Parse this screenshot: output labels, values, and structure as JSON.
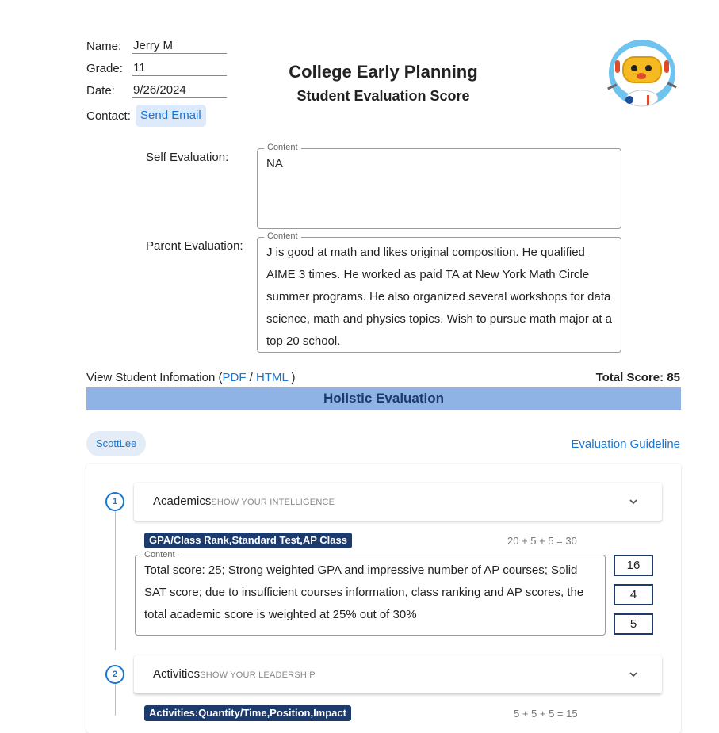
{
  "student": {
    "name_label": "Name:",
    "name_value": "Jerry M",
    "grade_label": "Grade:",
    "grade_value": "11",
    "date_label": "Date:",
    "date_value": "9/26/2024",
    "contact_label": "Contact:",
    "send_email_label": "Send Email"
  },
  "header": {
    "title": "College Early Planning",
    "subtitle": "Student Evaluation Score",
    "mascot_icon": "astronaut-mascot"
  },
  "self_evaluation": {
    "label": "Self Evaluation:",
    "legend": "Content",
    "text": "NA"
  },
  "parent_evaluation": {
    "label": "Parent Evaluation:",
    "legend": "Content",
    "text": "J is good at math and likes original composition. He qualified AIME 3 times. He worked as paid TA at New York Math Circle summer programs. He also organized several workshops for data science, math and physics topics. Wish to pursue math major at a top 20 school."
  },
  "student_info": {
    "prefix": "View Student Infomation (",
    "pdf_label": "PDF",
    "separator": " / ",
    "html_label": "HTML",
    "suffix": " )",
    "total_score": "Total Score: 85"
  },
  "holistic": {
    "title": "Holistic Evaluation",
    "evaluator_chip": "ScottLee",
    "guideline_link": "Evaluation Guideline"
  },
  "steps": [
    {
      "number": "1",
      "title": "Academics",
      "subtitle": "SHOW YOUR INTELLIGENCE",
      "tag": "GPA/Class Rank,Standard Test,AP Class",
      "formula": "20 + 5 + 5 = 30",
      "legend": "Content",
      "comment": "Total score: 25; Strong weighted GPA and impressive number of AP courses; Solid SAT score; due to insufficient courses information, class ranking and AP scores, the total academic score is weighted at 25% out of 30%",
      "scores": [
        "16",
        "4",
        "5"
      ]
    },
    {
      "number": "2",
      "title": "Activities",
      "subtitle": "SHOW YOUR LEADERSHIP",
      "tag": "Activities:Quantity/Time,Position,Impact",
      "formula": "5 + 5 + 5 = 15"
    }
  ],
  "colors": {
    "accent": "#1976d2",
    "navy": "#1c3a6b",
    "holistic_bar": "#8fb3e5",
    "chip_bg": "#e3ecf7"
  }
}
